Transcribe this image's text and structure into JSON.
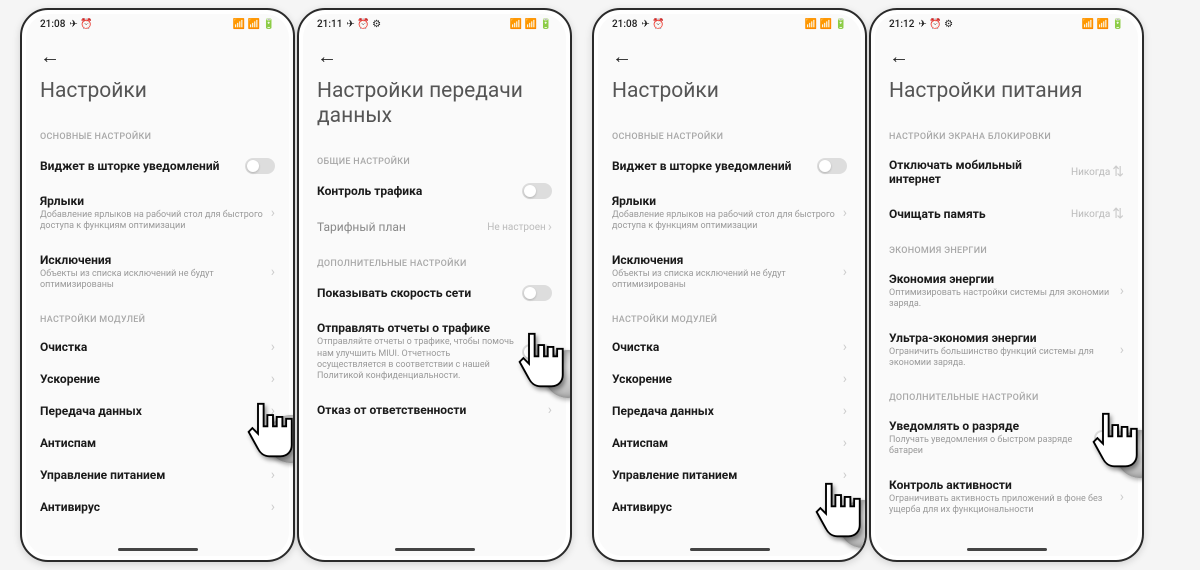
{
  "screens": [
    {
      "status": {
        "time": "21:08",
        "icons_left": "✈ ⏰",
        "icons_right": "📶 📶 🔋"
      },
      "title": "Настройки",
      "sections": [
        {
          "header": "ОСНОВНЫЕ НАСТРОЙКИ",
          "rows": [
            {
              "label": "Виджет в шторке уведомлений",
              "kind": "toggle"
            },
            {
              "label": "Ярлыки",
              "sub": "Добавление ярлыков на рабочий стол для быстрого доступа к функциям оптимизации",
              "kind": "link"
            },
            {
              "label": "Исключения",
              "sub": "Объекты из списка исключений не будут оптимизированы",
              "kind": "link"
            }
          ]
        },
        {
          "header": "НАСТРОЙКИ МОДУЛЕЙ",
          "rows": [
            {
              "label": "Очистка",
              "kind": "link"
            },
            {
              "label": "Ускорение",
              "kind": "link"
            },
            {
              "label": "Передача данных",
              "kind": "link"
            },
            {
              "label": "Антиспам",
              "kind": "link"
            },
            {
              "label": "Управление питанием",
              "kind": "link"
            },
            {
              "label": "Антивирус",
              "kind": "link"
            }
          ]
        }
      ]
    },
    {
      "status": {
        "time": "21:11",
        "icons_left": "✈ ⏰ ⚙",
        "icons_right": "📶 📶 🔋"
      },
      "title": "Настройки передачи данных",
      "sections": [
        {
          "header": "ОБЩИЕ НАСТРОЙКИ",
          "rows": [
            {
              "label": "Контроль трафика",
              "kind": "toggle"
            },
            {
              "label": "Тарифный план",
              "value": "Не настроен",
              "kind": "link"
            }
          ]
        },
        {
          "header": "ДОПОЛНИТЕЛЬНЫЕ НАСТРОЙКИ",
          "rows": [
            {
              "label": "Показывать скорость сети",
              "kind": "toggle"
            },
            {
              "label": "Отправлять отчеты о трафике",
              "sub": "Отправляйте отчеты о трафике, чтобы помочь нам улучшить MIUI. Отчетность осуществляется в соответствии с нашей Политикой конфиденциальности.",
              "kind": "toggle"
            },
            {
              "label": "Отказ от ответственности",
              "kind": "link"
            }
          ]
        }
      ]
    },
    {
      "status": {
        "time": "21:08",
        "icons_left": "✈ ⏰",
        "icons_right": "📶 📶 🔋"
      },
      "title": "Настройки",
      "sections": [
        {
          "header": "ОСНОВНЫЕ НАСТРОЙКИ",
          "rows": [
            {
              "label": "Виджет в шторке уведомлений",
              "kind": "toggle"
            },
            {
              "label": "Ярлыки",
              "sub": "Добавление ярлыков на рабочий стол для быстрого доступа к функциям оптимизации",
              "kind": "link"
            },
            {
              "label": "Исключения",
              "sub": "Объекты из списка исключений не будут оптимизированы",
              "kind": "link"
            }
          ]
        },
        {
          "header": "НАСТРОЙКИ МОДУЛЕЙ",
          "rows": [
            {
              "label": "Очистка",
              "kind": "link"
            },
            {
              "label": "Ускорение",
              "kind": "link"
            },
            {
              "label": "Передача данных",
              "kind": "link"
            },
            {
              "label": "Антиспам",
              "kind": "link"
            },
            {
              "label": "Управление питанием",
              "kind": "link"
            },
            {
              "label": "Антивирус",
              "kind": "link"
            }
          ]
        }
      ]
    },
    {
      "status": {
        "time": "21:12",
        "icons_left": "✈ ⏰ ⚙",
        "icons_right": "📶 📶 🔋"
      },
      "title": "Настройки питания",
      "sections": [
        {
          "header": "НАСТРОЙКИ ЭКРАНА БЛОКИРОВКИ",
          "rows": [
            {
              "label": "Отключать мобильный интернет",
              "value": "Никогда",
              "kind": "pick"
            },
            {
              "label": "Очищать память",
              "value": "Никогда",
              "kind": "pick"
            }
          ]
        },
        {
          "header": "ЭКОНОМИЯ ЭНЕРГИИ",
          "rows": [
            {
              "label": "Экономия энергии",
              "sub": "Оптимизировать настройки системы для экономии заряда.",
              "kind": "link"
            },
            {
              "label": "Ультра-экономия энергии",
              "sub": "Ограничить большинство функций системы для экономии заряда.",
              "kind": "link"
            }
          ]
        },
        {
          "header": "ДОПОЛНИТЕЛЬНЫЕ НАСТРОЙКИ",
          "rows": [
            {
              "label": "Уведомлять о разряде",
              "sub": "Получать уведомления о быстром разряде батареи",
              "kind": "toggle"
            },
            {
              "label": "Контроль активности",
              "sub": "Ограничивать активность приложений в фоне без ущерба для их функциональности",
              "kind": "link"
            }
          ]
        }
      ]
    }
  ]
}
